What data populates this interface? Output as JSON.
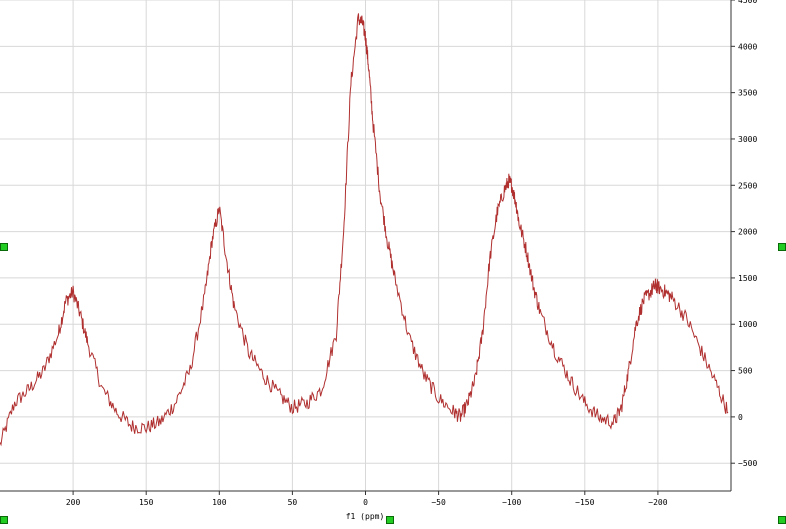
{
  "chart_data": {
    "type": "line",
    "xlabel": "f1 (ppm)",
    "ylabel": "",
    "title": "",
    "xlim": [
      250,
      -250
    ],
    "ylim": [
      -800,
      4500
    ],
    "x_ticks": [
      200,
      150,
      100,
      50,
      0,
      -50,
      -100,
      -150,
      -200
    ],
    "x_tick_labels": [
      "200",
      "150",
      "100",
      "50",
      "0",
      "−50",
      "−100",
      "−150",
      "−200"
    ],
    "y_ticks": [
      -500,
      0,
      500,
      1000,
      1500,
      2000,
      2500,
      3000,
      3500,
      4000,
      4500
    ],
    "y_tick_labels": [
      "−500",
      "0",
      "500",
      "1000",
      "1500",
      "2000",
      "2500",
      "3000",
      "3500",
      "4000",
      "4500"
    ],
    "grid": true,
    "series": [
      {
        "color": "#b03030",
        "x": [
          250,
          240,
          230,
          220,
          210,
          205,
          200,
          195,
          190,
          180,
          170,
          160,
          150,
          140,
          130,
          120,
          110,
          105,
          100,
          95,
          90,
          80,
          70,
          60,
          50,
          40,
          30,
          20,
          15,
          10,
          5,
          2,
          0,
          -2,
          -5,
          -10,
          -15,
          -20,
          -30,
          -40,
          -50,
          -60,
          -65,
          -70,
          -75,
          -80,
          -85,
          -90,
          -95,
          -98,
          -100,
          -103,
          -105,
          -110,
          -115,
          -120,
          -130,
          -140,
          -150,
          -160,
          -170,
          -175,
          -180,
          -185,
          -190,
          -195,
          -198,
          -200,
          -205,
          -210,
          -220,
          -230,
          -240,
          -248
        ],
        "y": [
          -300,
          150,
          300,
          500,
          900,
          1250,
          1350,
          1100,
          800,
          300,
          50,
          -100,
          -120,
          -50,
          150,
          500,
          1300,
          1900,
          2250,
          1700,
          1200,
          700,
          450,
          250,
          100,
          150,
          300,
          900,
          2000,
          3600,
          4300,
          4250,
          4100,
          3800,
          3200,
          2400,
          1900,
          1500,
          850,
          450,
          200,
          60,
          0,
          150,
          400,
          900,
          1700,
          2200,
          2450,
          2550,
          2500,
          2300,
          2100,
          1800,
          1400,
          1100,
          700,
          400,
          150,
          -10,
          -60,
          100,
          500,
          1000,
          1250,
          1350,
          1420,
          1400,
          1350,
          1280,
          1050,
          700,
          350,
          50
        ]
      }
    ]
  }
}
